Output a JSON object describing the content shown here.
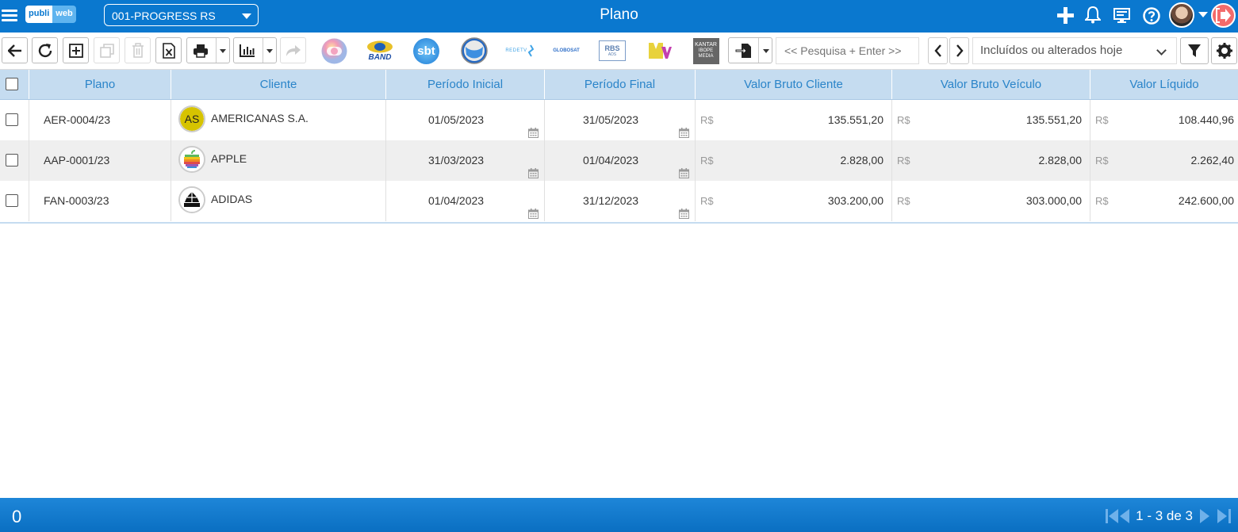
{
  "header": {
    "logo_part1": "publi",
    "logo_part2": "web",
    "company": "001-PROGRESS RS",
    "title": "Plano"
  },
  "toolbar": {
    "search_placeholder": "<< Pesquisa + Enter >>",
    "filter_selected": "Incluídos ou alterados hoje",
    "channels": [
      "GLOBO",
      "BAND",
      "SBT",
      "RECORD",
      "REDETV",
      "GLOBOSAT",
      "RBS ADS",
      "MTV",
      "KANTAR IBOPE MEDIA"
    ],
    "channel_text": {
      "band": "BAND",
      "sbt": "sbt",
      "redetv": "REDETV",
      "globosat": "GLOBOSAT",
      "rbs_top": "RBS",
      "rbs_bottom": "ADS",
      "kantar": "KANTAR",
      "ibope": "IBOPE",
      "media": "MEDIA"
    }
  },
  "table": {
    "columns": [
      "Plano",
      "Cliente",
      "Período Inicial",
      "Período Final",
      "Valor Bruto Cliente",
      "Valor Bruto Veículo",
      "Valor Líquido"
    ],
    "currency": "R$",
    "rows": [
      {
        "plano": "AER-0004/23",
        "cliente": "AMERICANAS S.A.",
        "logo_text": "AS",
        "inicio": "01/05/2023",
        "fim": "31/05/2023",
        "bruto_cliente": "135.551,20",
        "bruto_veiculo": "135.551,20",
        "liquido": "108.440,96"
      },
      {
        "plano": "AAP-0001/23",
        "cliente": "APPLE",
        "logo_text": "",
        "inicio": "31/03/2023",
        "fim": "01/04/2023",
        "bruto_cliente": "2.828,00",
        "bruto_veiculo": "2.828,00",
        "liquido": "2.262,40"
      },
      {
        "plano": "FAN-0003/23",
        "cliente": "ADIDAS",
        "logo_text": "",
        "inicio": "01/04/2023",
        "fim": "31/12/2023",
        "bruto_cliente": "303.200,00",
        "bruto_veiculo": "303.000,00",
        "liquido": "242.600,00"
      }
    ]
  },
  "footer": {
    "selected_count": "0",
    "pagination": "1 - 3 de 3"
  },
  "colors": {
    "primary": "#0a78cf",
    "header_row": "#c5dcf0",
    "column_text": "#2a84c9",
    "exit": "#f36b6b"
  }
}
